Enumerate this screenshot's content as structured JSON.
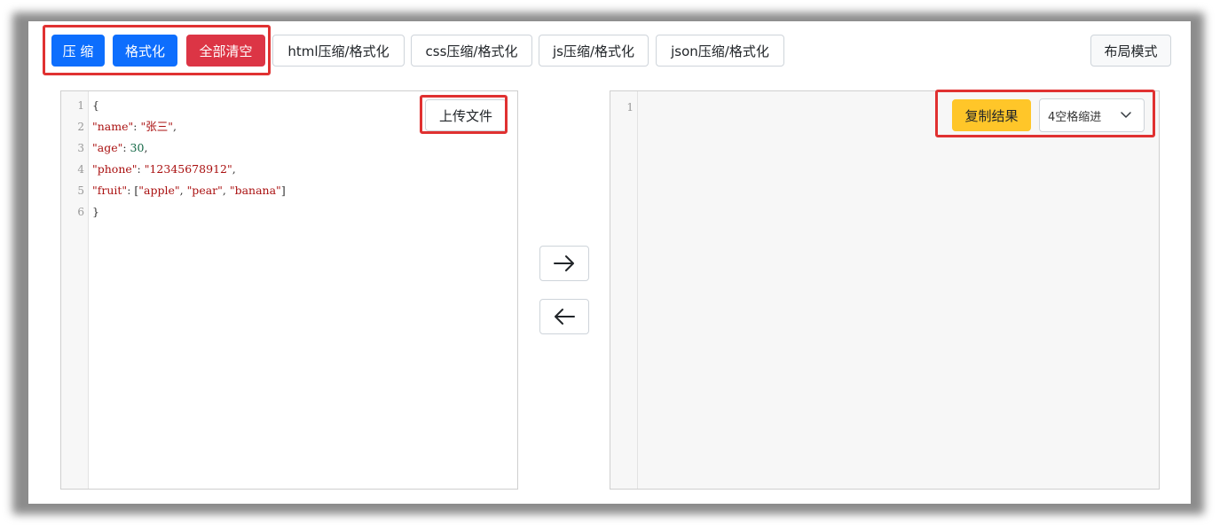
{
  "toolbar": {
    "compress_label": "压 缩",
    "format_label": "格式化",
    "clear_all_label": "全部清空",
    "tabs": [
      {
        "label": "html压缩/格式化"
      },
      {
        "label": "css压缩/格式化"
      },
      {
        "label": "js压缩/格式化"
      },
      {
        "label": "json压缩/格式化"
      }
    ],
    "layout_mode_label": "布局模式"
  },
  "input_editor": {
    "upload_label": "上传文件",
    "line_numbers": [
      "1",
      "2",
      "3",
      "4",
      "5",
      "6"
    ],
    "lines": [
      [
        {
          "t": "{",
          "c": "p"
        }
      ],
      [
        {
          "t": "\"name\"",
          "c": "s"
        },
        {
          "t": ": ",
          "c": "p"
        },
        {
          "t": "\"张三\"",
          "c": "s"
        },
        {
          "t": ",",
          "c": "p"
        }
      ],
      [
        {
          "t": "\"age\"",
          "c": "s"
        },
        {
          "t": ": ",
          "c": "p"
        },
        {
          "t": "30",
          "c": "n"
        },
        {
          "t": ",",
          "c": "p"
        }
      ],
      [
        {
          "t": "\"phone\"",
          "c": "s"
        },
        {
          "t": ": ",
          "c": "p"
        },
        {
          "t": "\"12345678912\"",
          "c": "s"
        },
        {
          "t": ",",
          "c": "p"
        }
      ],
      [
        {
          "t": "\"fruit\"",
          "c": "s"
        },
        {
          "t": ": [",
          "c": "p"
        },
        {
          "t": "\"apple\"",
          "c": "s"
        },
        {
          "t": ", ",
          "c": "p"
        },
        {
          "t": "\"pear\"",
          "c": "s"
        },
        {
          "t": ", ",
          "c": "p"
        },
        {
          "t": "\"banana\"",
          "c": "s"
        },
        {
          "t": "]",
          "c": "p"
        }
      ],
      [
        {
          "t": "}",
          "c": "p"
        }
      ]
    ]
  },
  "transfer": {
    "forward_icon": "arrow-right-icon",
    "backward_icon": "arrow-left-icon"
  },
  "output_editor": {
    "copy_label": "复制结果",
    "line_numbers": [
      "1"
    ],
    "indent_select": {
      "selected": "4空格缩进"
    }
  },
  "colors": {
    "primary": "#0d6efd",
    "danger": "#dc3545",
    "warning": "#ffc629",
    "highlight": "#e03131"
  }
}
